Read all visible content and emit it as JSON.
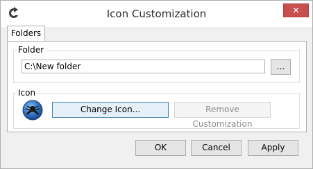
{
  "window": {
    "title": "Icon Customization",
    "close_glyph": "✕",
    "app_icon": "app-icon"
  },
  "tabs": [
    {
      "label": "Folders",
      "selected": true
    }
  ],
  "folder_group": {
    "label": "Folder",
    "path_value": "C:\\New folder",
    "browse_label": "..."
  },
  "icon_group": {
    "label": "Icon",
    "folder_icon": "globe-folder-icon",
    "change_label": "Change Icon...",
    "remove_label": "Remove Customization"
  },
  "buttons": {
    "ok": "OK",
    "cancel": "Cancel",
    "apply": "Apply"
  },
  "colors": {
    "close_button": "#c7504f",
    "focus_border": "#3c7fb1"
  }
}
